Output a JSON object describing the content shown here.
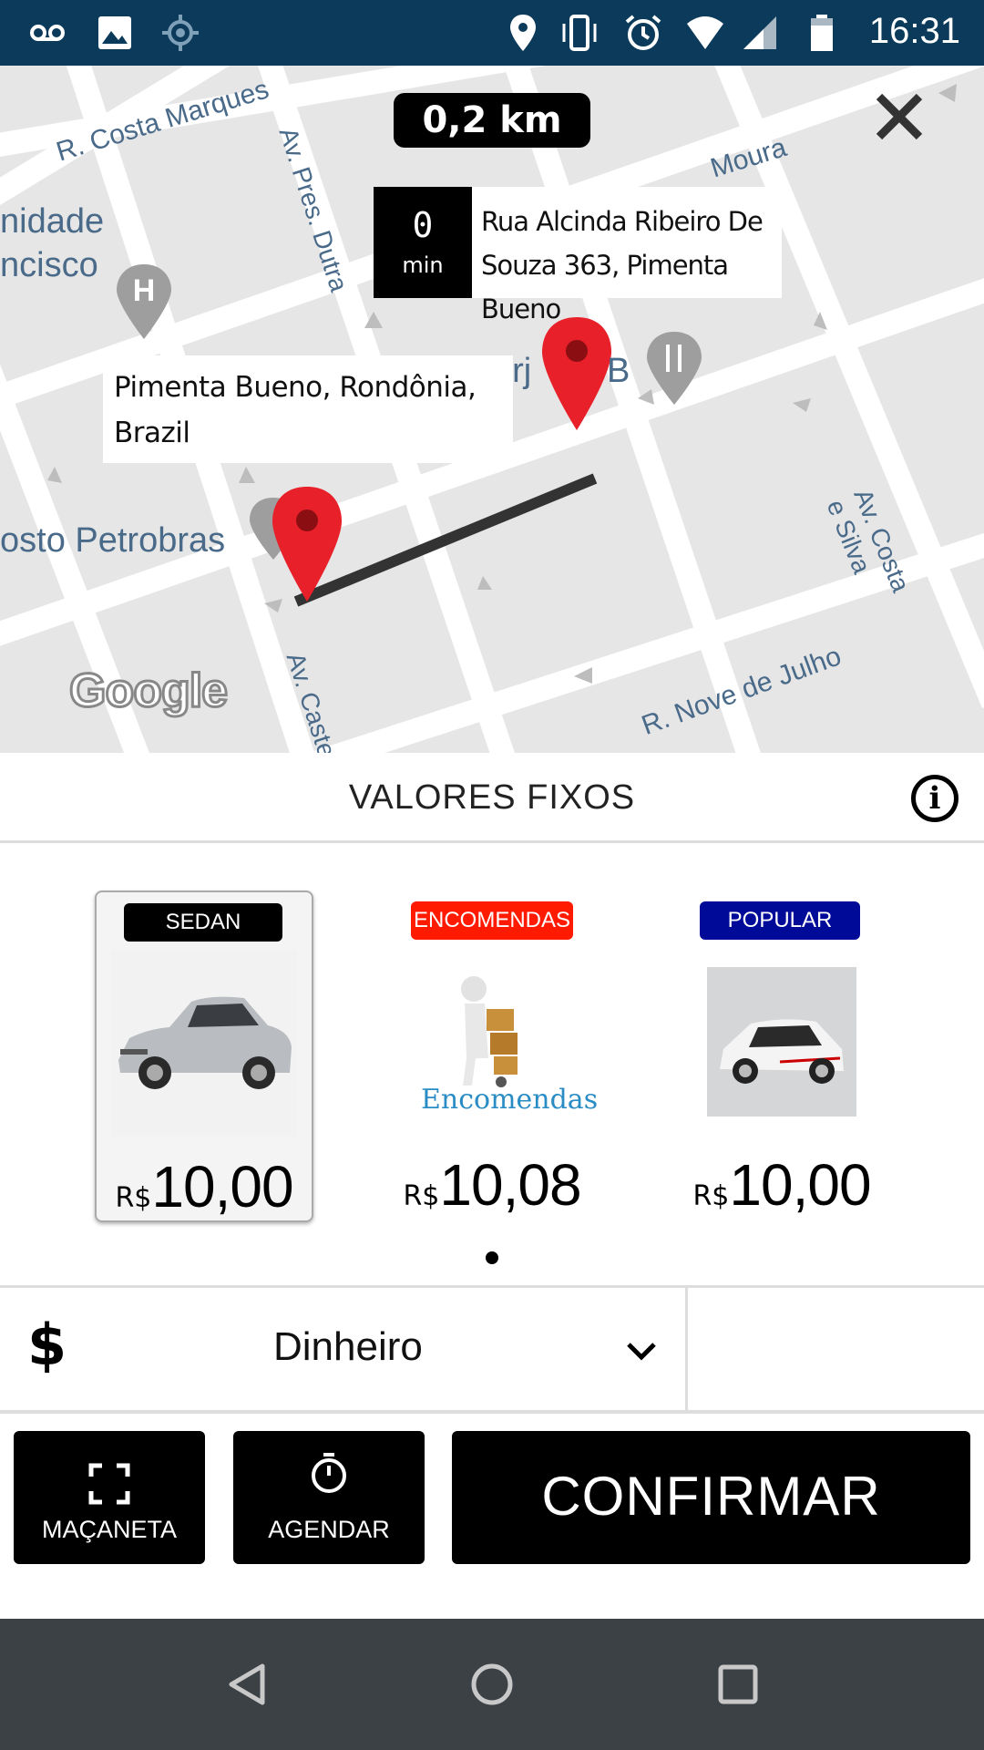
{
  "status_bar": {
    "time": "16:31",
    "icons": [
      "voicemail-icon",
      "image-icon",
      "gps-icon",
      "location-icon",
      "vibrate-icon",
      "alarm-icon",
      "wifi-icon",
      "signal-icon",
      "battery-icon"
    ]
  },
  "map": {
    "distance": "0,2 km",
    "destination": {
      "minutes": "0",
      "unit": "min",
      "address": "Rua Alcinda Ribeiro De Souza 363, Pimenta Bueno"
    },
    "origin": {
      "address": "Pimenta Bueno, Rondônia, Brazil"
    },
    "labels": {
      "costa_marques": "R. Costa Marques",
      "pres_dutra": "Av. Pres. Dutra",
      "moura": "Moura",
      "unidade": "nidade",
      "ncisco": "ncisco",
      "posto": "osto Petrobras",
      "costa_silva": "Av. Costa e Silva",
      "nove_julho": "R. Nove de Julho",
      "castelo": "Av. Caste",
      "verj": "verj",
      "b": "B"
    },
    "logo": "Google"
  },
  "section": {
    "title": "VALORES FIXOS"
  },
  "cards": [
    {
      "tag": "SEDAN",
      "tag_color": "#000000",
      "currency": "R$",
      "price": "10,00",
      "selected": true
    },
    {
      "tag": "ENCOMENDAS",
      "tag_color": "#ff1a00",
      "currency": "R$",
      "price": "10,08",
      "image_text": "Encomendas"
    },
    {
      "tag": "POPULAR",
      "tag_color": "#000a99",
      "currency": "R$",
      "price": "10,00"
    }
  ],
  "payment": {
    "symbol": "$",
    "method": "Dinheiro"
  },
  "actions": {
    "handle_label": "MAÇANETA",
    "schedule_label": "AGENDAR",
    "confirm_label": "CONFIRMAR"
  }
}
